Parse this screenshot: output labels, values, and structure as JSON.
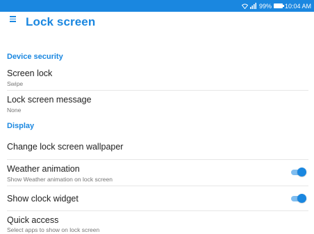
{
  "status_bar": {
    "battery": "99%",
    "time": "10:04 AM",
    "icons": [
      "wifi-icon",
      "signal-icon",
      "battery-icon"
    ]
  },
  "header": {
    "title": "Lock screen",
    "menu_icon": "menu-icon"
  },
  "sections": {
    "device_security": "Device security",
    "display": "Display"
  },
  "settings": {
    "screen_lock": {
      "title": "Screen lock",
      "summary": "Swipe"
    },
    "lock_screen_message": {
      "title": "Lock screen message",
      "summary": "None"
    },
    "change_wallpaper": {
      "title": "Change lock screen wallpaper"
    },
    "weather_animation": {
      "title": "Weather animation",
      "summary": "Show Weather animation on lock screen",
      "enabled": true
    },
    "show_clock_widget": {
      "title": "Show clock widget",
      "enabled": true
    },
    "quick_access": {
      "title": "Quick access",
      "summary": "Select apps to show on lock screen"
    }
  },
  "colors": {
    "accent": "#1a87e0",
    "toggle_track": "#7fbdf0",
    "text_primary": "#212121",
    "text_secondary": "#757575"
  }
}
